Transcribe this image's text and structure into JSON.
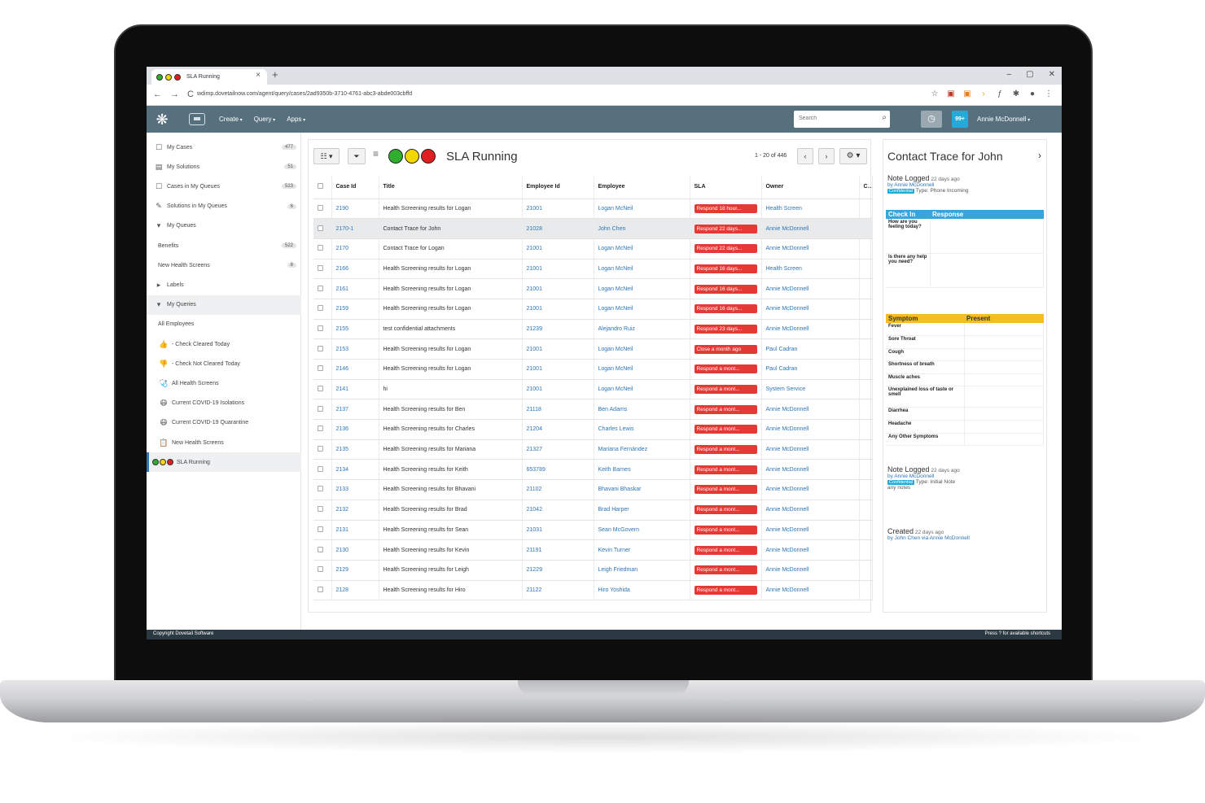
{
  "browser": {
    "tab_title": "SLA Running",
    "tab_close": "×",
    "new_tab": "+",
    "window_controls": [
      "–",
      "▢",
      "✕"
    ],
    "nav": [
      "←",
      "→",
      "C"
    ],
    "url": "wdimp.dovetailnow.com/agent/query/cases/2ad9350b-3710-4761-abc3-abde003cbffd"
  },
  "header": {
    "menu": [
      "Create",
      "Query",
      "Apps"
    ],
    "search_placeholder": "Search",
    "notifications": "99+",
    "user": "Annie McDonnell"
  },
  "sidebar": {
    "items": [
      {
        "label": "My Cases",
        "icon": "☐",
        "count": "477"
      },
      {
        "label": "My Solutions",
        "icon": "▤",
        "count": "51"
      },
      {
        "label": "Cases in My Queues",
        "icon": "☐",
        "count": "523"
      },
      {
        "label": "Solutions in My Queues",
        "icon": "✎",
        "count": "6"
      },
      {
        "label": "My Queues",
        "icon": "▾",
        "count": ""
      },
      {
        "label": "Benefits",
        "icon": "",
        "count": "522"
      },
      {
        "label": "New Health Screens",
        "icon": "",
        "count": "8"
      },
      {
        "label": "Labels",
        "icon": "▸",
        "count": ""
      },
      {
        "label": "My Queries",
        "icon": "▾",
        "count": ""
      },
      {
        "label": "All Employees",
        "icon": "",
        "count": ""
      },
      {
        "label": "- Check Cleared Today",
        "icon": "👍",
        "count": ""
      },
      {
        "label": "- Check Not Cleared Today",
        "icon": "👎",
        "count": ""
      },
      {
        "label": "All Health Screens",
        "icon": "🩺",
        "count": ""
      },
      {
        "label": "Current COVID-19 Isolations",
        "icon": "😷",
        "count": ""
      },
      {
        "label": "Current COVID-19 Quarantine",
        "icon": "😷",
        "count": ""
      },
      {
        "label": "New Health Screens",
        "icon": "📋",
        "count": ""
      },
      {
        "label": "SLA Running",
        "icon": "dots",
        "count": ""
      }
    ]
  },
  "main": {
    "title": "SLA Running",
    "pager": "1 - 20 of 446",
    "columns": [
      "Case Id",
      "Title",
      "Employee Id",
      "Employee",
      "SLA",
      "Owner",
      "C"
    ],
    "rows": [
      {
        "id": "2190",
        "title": "Health Screening results for Logan",
        "emp_id": "21001",
        "employee": "Logan McNeil",
        "sla": "Respond 18 hour...",
        "owner": "Health Screen"
      },
      {
        "id": "2170-1",
        "title": "Contact Trace for John",
        "emp_id": "21028",
        "employee": "John Chen",
        "sla": "Respond 22 days...",
        "owner": "Annie McDonnell"
      },
      {
        "id": "2170",
        "title": "Contact Trace for Logan",
        "emp_id": "21001",
        "employee": "Logan McNeil",
        "sla": "Respond 22 days...",
        "owner": "Annie McDonnell"
      },
      {
        "id": "2166",
        "title": "Health Screening results for Logan",
        "emp_id": "21001",
        "employee": "Logan McNeil",
        "sla": "Respond 16 days...",
        "owner": "Health Screen"
      },
      {
        "id": "2161",
        "title": "Health Screening results for Logan",
        "emp_id": "21001",
        "employee": "Logan McNeil",
        "sla": "Respond 16 days...",
        "owner": "Annie McDonnell"
      },
      {
        "id": "2159",
        "title": "Health Screening results for Logan",
        "emp_id": "21001",
        "employee": "Logan McNeil",
        "sla": "Respond 16 days...",
        "owner": "Annie McDonnell"
      },
      {
        "id": "2155",
        "title": "test confidential attachments",
        "emp_id": "21239",
        "employee": "Alejandro Ruiz",
        "sla": "Respond 23 days...",
        "owner": "Annie McDonnell"
      },
      {
        "id": "2153",
        "title": "Health Screening results for Logan",
        "emp_id": "21001",
        "employee": "Logan McNeil",
        "sla": "Close a month ago",
        "owner": "Paul Cadran"
      },
      {
        "id": "2146",
        "title": "Health Screening results for Logan",
        "emp_id": "21001",
        "employee": "Logan McNeil",
        "sla": "Respond a mont...",
        "owner": "Paul Cadran"
      },
      {
        "id": "2141",
        "title": "hi",
        "emp_id": "21001",
        "employee": "Logan McNeil",
        "sla": "Respond a mont...",
        "owner": "System Service"
      },
      {
        "id": "2137",
        "title": "Health Screening results for Ben",
        "emp_id": "21118",
        "employee": "Ben Adams",
        "sla": "Respond a mont...",
        "owner": "Annie McDonnell"
      },
      {
        "id": "2136",
        "title": "Health Screening results for Charles",
        "emp_id": "21204",
        "employee": "Charles Lewis",
        "sla": "Respond a mont...",
        "owner": "Annie McDonnell"
      },
      {
        "id": "2135",
        "title": "Health Screening results for Mariana",
        "emp_id": "21327",
        "employee": "Mariana Fernández",
        "sla": "Respond a mont...",
        "owner": "Annie McDonnell"
      },
      {
        "id": "2134",
        "title": "Health Screening results for Keith",
        "emp_id": "653789",
        "employee": "Keith Barnes",
        "sla": "Respond a mont...",
        "owner": "Annie McDonnell"
      },
      {
        "id": "2133",
        "title": "Health Screening results for Bhavani",
        "emp_id": "21102",
        "employee": "Bhavani Bhaskar",
        "sla": "Respond a mont...",
        "owner": "Annie McDonnell"
      },
      {
        "id": "2132",
        "title": "Health Screening results for Brad",
        "emp_id": "21042",
        "employee": "Brad Harper",
        "sla": "Respond a mont...",
        "owner": "Annie McDonnell"
      },
      {
        "id": "2131",
        "title": "Health Screening results for Sean",
        "emp_id": "21031",
        "employee": "Sean McGovern",
        "sla": "Respond a mont...",
        "owner": "Annie McDonnell"
      },
      {
        "id": "2130",
        "title": "Health Screening results for Kevin",
        "emp_id": "21191",
        "employee": "Kevin Turner",
        "sla": "Respond a mont...",
        "owner": "Annie McDonnell"
      },
      {
        "id": "2129",
        "title": "Health Screening results for Leigh",
        "emp_id": "21229",
        "employee": "Leigh Friedman",
        "sla": "Respond a mont...",
        "owner": "Annie McDonnell"
      },
      {
        "id": "2128",
        "title": "Health Screening results for Hiro",
        "emp_id": "21122",
        "employee": "Hiro Yoshida",
        "sla": "Respond a mont...",
        "owner": "Annie McDonnell"
      }
    ]
  },
  "panel": {
    "title": "Contact Trace for John",
    "note1": {
      "title": "Note Logged",
      "ago": "22 days ago",
      "by": "by Annie McDonnell",
      "badge": "Confidential",
      "type": "Type: Phone Incoming"
    },
    "checkin_header": [
      "Check In",
      "Response"
    ],
    "checkin_rows": [
      "How are you feeling today?",
      "Is there any help you need?"
    ],
    "symptom_header": [
      "Symptom",
      "Present"
    ],
    "symptoms": [
      "Fever",
      "Sore Throat",
      "Cough",
      "Shortness of breath",
      "Muscle aches",
      "Unexplained loss of taste or smell",
      "Diarrhea",
      "Headache",
      "Any Other Symptoms"
    ],
    "note2": {
      "title": "Note Logged",
      "ago": "22 days ago",
      "by": "by Annie McDonnell",
      "badge": "Confidential",
      "type": "Type: Initial Note",
      "body": "any notes"
    },
    "created": {
      "title": "Created",
      "ago": "22 days ago",
      "by": "by John Chen via Annie McDonnell"
    }
  },
  "footer": {
    "left": "Copyright Dovetail Software",
    "right": "Press ? for available shortcuts"
  },
  "colors": {
    "header_bg": "#56707d",
    "sla_red": "#e53935",
    "link_blue": "#2d76b8",
    "checkin_blue": "#3aa4d8",
    "symptom_yellow": "#f5bd1f"
  }
}
